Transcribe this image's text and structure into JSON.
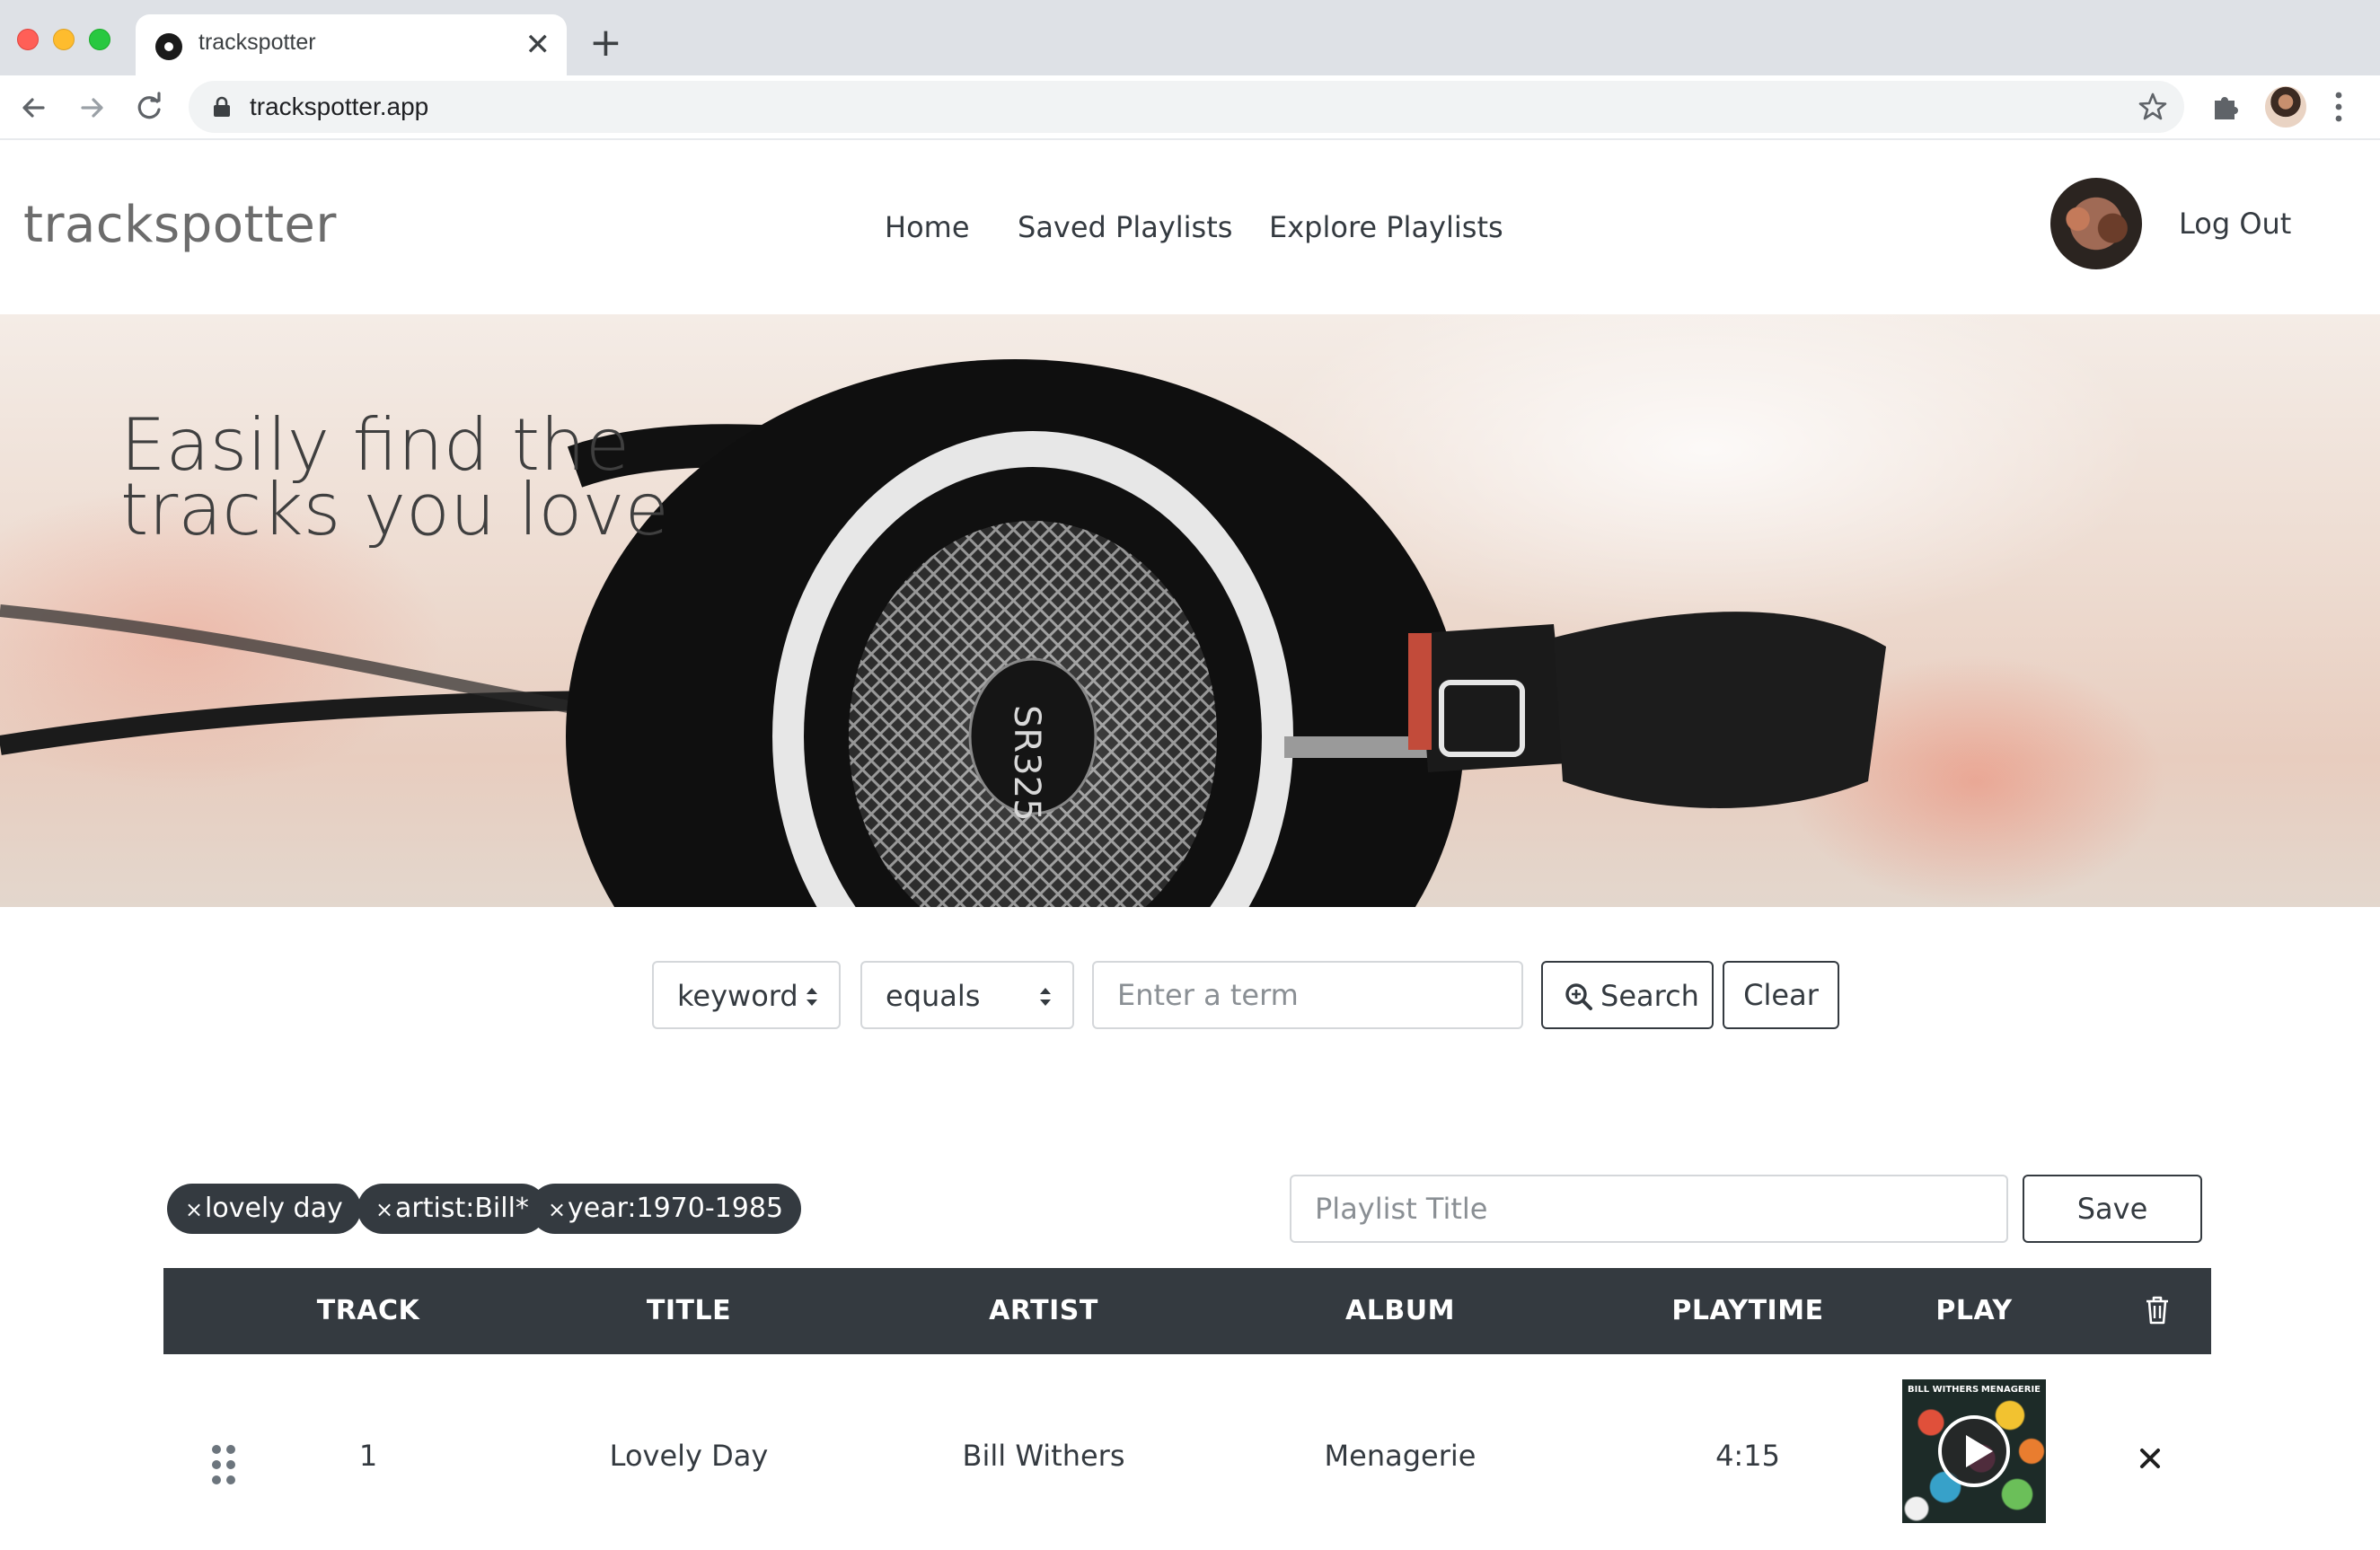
{
  "browser": {
    "tab_title": "trackspotter",
    "tab_close": "✕",
    "new_tab": "+",
    "url": "trackspotter.app"
  },
  "header": {
    "brand": "trackspotter",
    "nav": [
      "Home",
      "Saved Playlists",
      "Explore Playlists"
    ],
    "logout": "Log Out"
  },
  "hero": {
    "headline": "Easily find the\ntracks you love",
    "product_text": "SR325"
  },
  "search": {
    "field_select": "keyword",
    "operator_select": "equals",
    "term_placeholder": "Enter a term",
    "search_label": "Search",
    "clear_label": "Clear"
  },
  "filters": {
    "chip_remove": "×",
    "chips": [
      "lovely day",
      "artist:Bill*",
      "year:1970-1985"
    ]
  },
  "playlist": {
    "title_placeholder": "Playlist Title",
    "save_label": "Save"
  },
  "table": {
    "headers": [
      "TRACK",
      "TITLE",
      "ARTIST",
      "ALBUM",
      "PLAYTIME",
      "PLAY"
    ],
    "rows": [
      {
        "track": "1",
        "title": "Lovely Day",
        "artist": "Bill Withers",
        "album": "Menagerie",
        "playtime": "4:15",
        "cover_left_text": "BILL WITHERS",
        "cover_right_text": "MENAGERIE"
      }
    ]
  },
  "colors": {
    "dark": "#343a40",
    "border": "#d4d7da",
    "chrome": "#dee1e6"
  },
  "icons": [
    "lock-icon",
    "star-icon",
    "extensions-icon",
    "kebab-menu-icon",
    "search-icon",
    "trash-icon",
    "drag-handle-icon",
    "play-icon",
    "close-icon"
  ]
}
